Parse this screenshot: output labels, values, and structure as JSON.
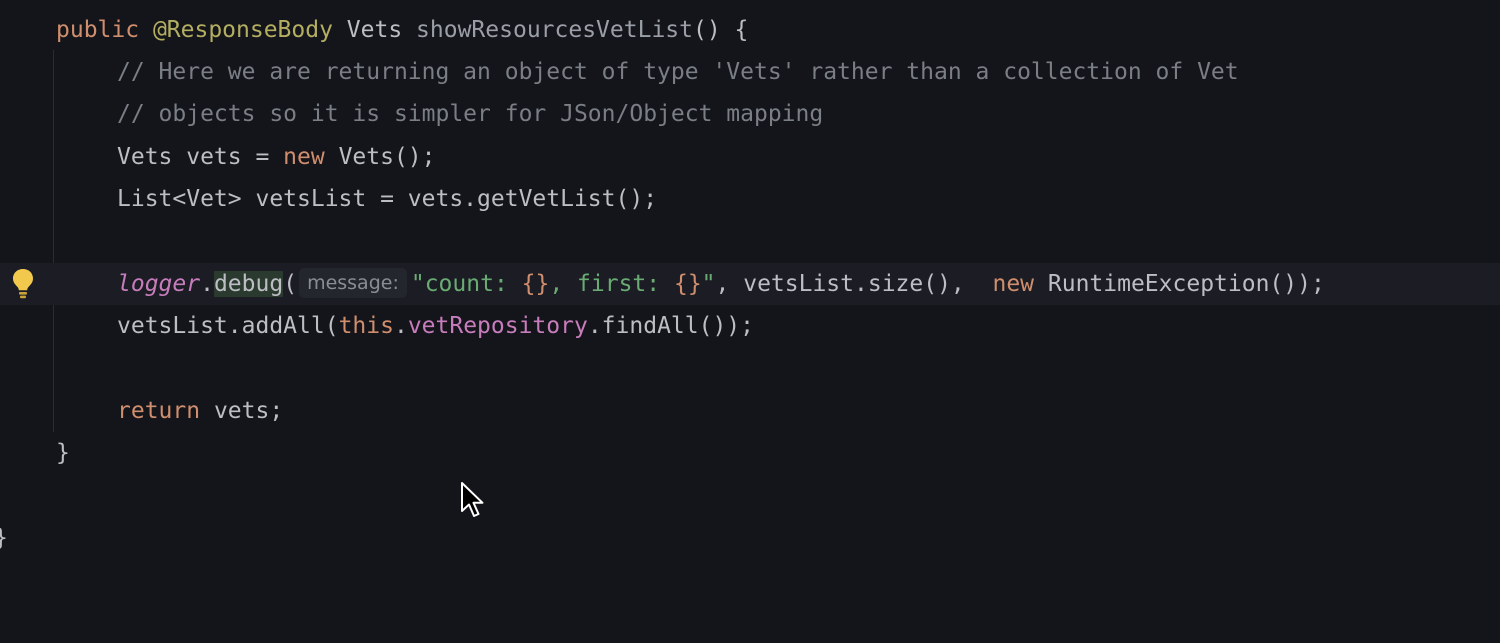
{
  "editor": {
    "line0": {
      "kw_public": "public ",
      "annotation": "@ResponseBody",
      "type_vets": " Vets ",
      "method": "showResourcesVetList",
      "tail": "() {"
    },
    "line1": {
      "comment": "// Here we are returning an object of type 'Vets' rather than a collection of Vet"
    },
    "line2": {
      "comment": "// objects so it is simpler for JSon/Object mapping"
    },
    "line3": {
      "a": "Vets vets = ",
      "kw_new": "new",
      "b": " Vets();"
    },
    "line4": {
      "text": "List<Vet> vetsList = vets.getVetList();"
    },
    "line6": {
      "logger": "logger",
      "dot": ".",
      "debug": "debug",
      "paren": "(",
      "hint": "message:",
      "str_open": "\"count: ",
      "ph1": "{}",
      "str_mid": ", first: ",
      "ph2": "{}",
      "str_close": "\"",
      "rest": ", vetsList.size(),  ",
      "kw_new": "new",
      "tail": " RuntimeException());"
    },
    "line7": {
      "a": "vetsList.addAll(",
      "kw_this": "this",
      "dot": ".",
      "field": "vetRepository",
      "b": ".findAll());"
    },
    "line9": {
      "kw_return": "return",
      "b": " vets;"
    },
    "line10": {
      "brace": "}"
    },
    "line12": {
      "brace": "}"
    }
  },
  "icons": {
    "intention": "lightbulb-icon",
    "pointer": "mouse-cursor-icon"
  },
  "colors": {
    "background": "#14141b",
    "keyword": "#cf8e6d",
    "annotation": "#b3ae60",
    "comment": "#7a7e85",
    "string": "#6aab73",
    "field": "#c77dbb",
    "bulb": "#f2c94c"
  }
}
